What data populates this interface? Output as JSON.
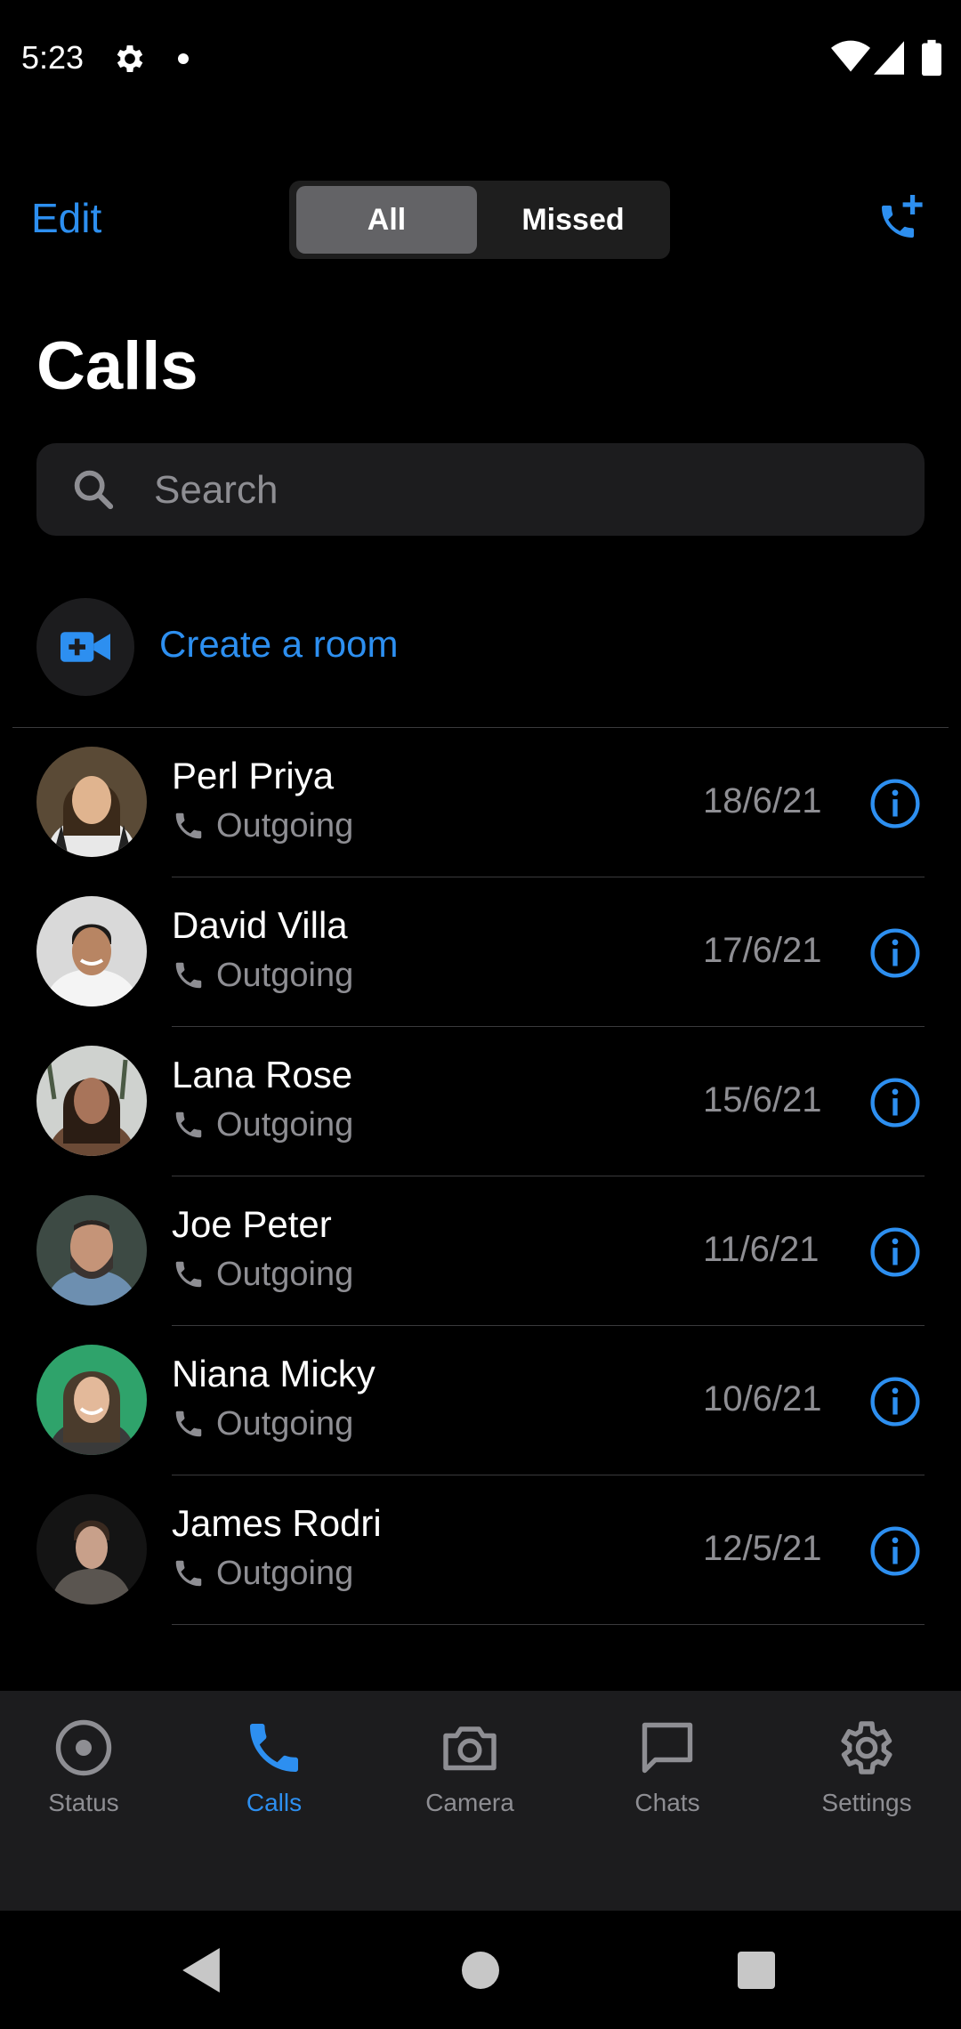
{
  "status_bar": {
    "time": "5:23"
  },
  "header": {
    "edit_label": "Edit",
    "segments": [
      "All",
      "Missed"
    ],
    "selected_segment": "All",
    "title": "Calls"
  },
  "search": {
    "placeholder": "Search",
    "value": ""
  },
  "create_room": {
    "label": "Create a room"
  },
  "calls": [
    {
      "name": "Perl Priya",
      "type": "Outgoing",
      "date": "18/6/21"
    },
    {
      "name": "David Villa",
      "type": "Outgoing",
      "date": "17/6/21"
    },
    {
      "name": "Lana Rose",
      "type": "Outgoing",
      "date": "15/6/21"
    },
    {
      "name": "Joe Peter",
      "type": "Outgoing",
      "date": "11/6/21"
    },
    {
      "name": "Niana Micky",
      "type": "Outgoing",
      "date": "10/6/21"
    },
    {
      "name": "James Rodri",
      "type": "Outgoing",
      "date": "12/5/21"
    }
  ],
  "tabs": [
    {
      "label": "Status",
      "icon": "status-icon",
      "active": false
    },
    {
      "label": "Calls",
      "icon": "phone-icon",
      "active": true
    },
    {
      "label": "Camera",
      "icon": "camera-icon",
      "active": false
    },
    {
      "label": "Chats",
      "icon": "chat-icon",
      "active": false
    },
    {
      "label": "Settings",
      "icon": "gear-icon",
      "active": false
    }
  ],
  "colors": {
    "accent": "#2d8ff0",
    "background": "#000000",
    "secondary_text": "#8e8e93",
    "surface": "#1c1c1e"
  }
}
